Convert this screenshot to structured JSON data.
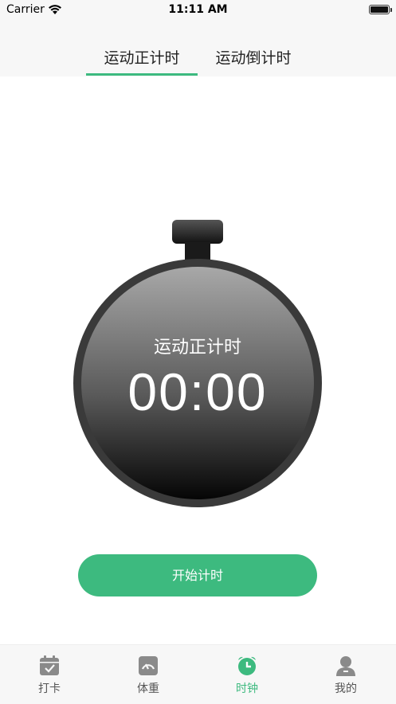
{
  "status_bar": {
    "carrier": "Carrier",
    "time": "11:11 AM"
  },
  "tabs": [
    {
      "label": "运动正计时",
      "active": true
    },
    {
      "label": "运动倒计时",
      "active": false
    }
  ],
  "timer": {
    "label": "运动正计时",
    "value": "00:00"
  },
  "start_button": {
    "label": "开始计时"
  },
  "tab_bar": [
    {
      "label": "打卡",
      "icon": "calendar-check-icon",
      "active": false
    },
    {
      "label": "体重",
      "icon": "scale-icon",
      "active": false
    },
    {
      "label": "时钟",
      "icon": "alarm-clock-icon",
      "active": true
    },
    {
      "label": "我的",
      "icon": "user-icon",
      "active": false
    }
  ],
  "colors": {
    "accent": "#3dba7f"
  }
}
